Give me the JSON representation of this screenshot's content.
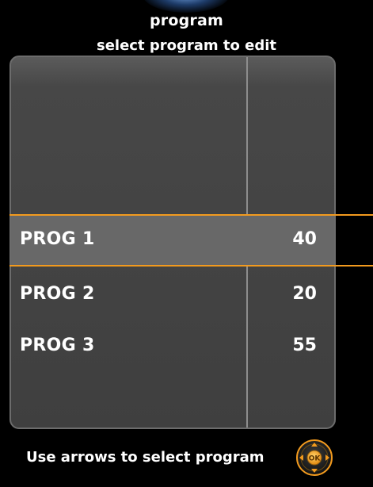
{
  "header": {
    "title": "program",
    "subtitle": "select program to edit"
  },
  "programs": [
    {
      "name": "PROG 1",
      "value": "40",
      "selected": true
    },
    {
      "name": "PROG 2",
      "value": "20",
      "selected": false
    },
    {
      "name": "PROG 3",
      "value": "55",
      "selected": false
    }
  ],
  "footer": {
    "hint": "Use arrows to select program",
    "ok_label": "OK",
    "nav_icon": "dpad-ok-icon"
  },
  "colors": {
    "background": "#000000",
    "panel": "#434343",
    "selection": "#f29a1e",
    "selected_row": "#686868",
    "text": "#ffffff"
  }
}
